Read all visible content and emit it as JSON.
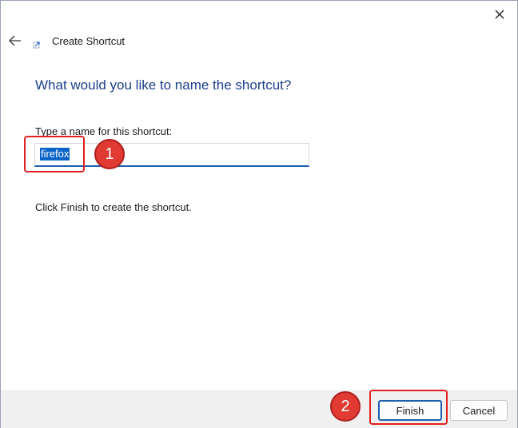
{
  "wizard": {
    "title": "Create Shortcut",
    "heading": "What would you like to name the shortcut?",
    "name_label": "Type a name for this shortcut:",
    "name_value": "firefox",
    "finish_note": "Click Finish to create the shortcut."
  },
  "buttons": {
    "finish_label": "Finish",
    "cancel_label": "Cancel"
  },
  "annotations": {
    "step1": "1",
    "step2": "2"
  },
  "icons": {
    "close": "close-icon",
    "back": "back-arrow-icon",
    "wizard": "shortcut-icon"
  },
  "colors": {
    "heading": "#1c3e8a",
    "accent": "#1f5fae",
    "selection": "#0a64c8",
    "annotation": "#e03a32"
  }
}
